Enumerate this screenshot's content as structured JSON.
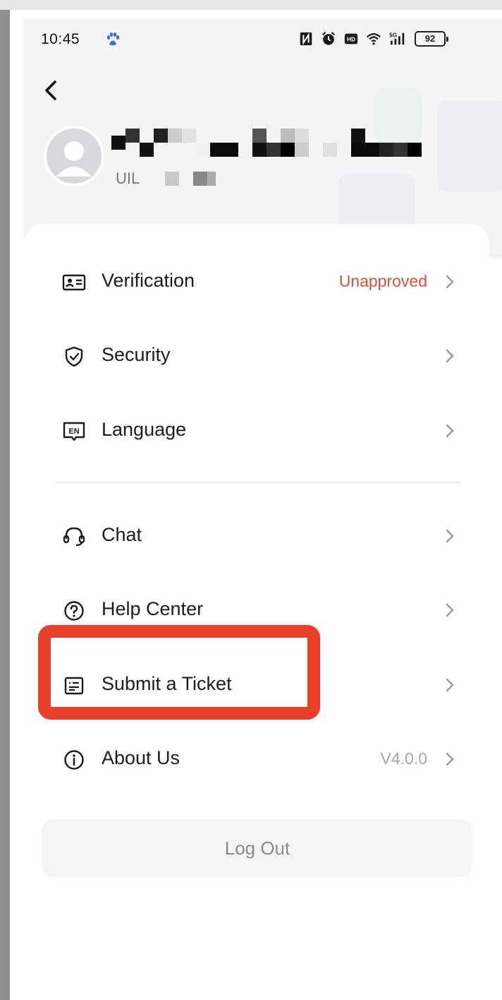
{
  "status_bar": {
    "time": "10:45",
    "battery": "92",
    "icons": [
      "baidu-paw-icon",
      "nfc-icon",
      "alarm-icon",
      "hd-icon",
      "wifi-icon",
      "5g-signal-icon",
      "battery-icon"
    ]
  },
  "header": {
    "back_icon": "chevron-left-icon"
  },
  "profile": {
    "uid_label": "UIL"
  },
  "menu": {
    "items": [
      {
        "label": "Verification",
        "value": "Unapproved",
        "icon": "id-card-icon"
      },
      {
        "label": "Security",
        "value": "",
        "icon": "shield-check-icon"
      },
      {
        "label": "Language",
        "value": "",
        "icon": "en-language-icon"
      },
      {
        "label": "Chat",
        "value": "",
        "icon": "headset-icon"
      },
      {
        "label": "Help Center",
        "value": "",
        "icon": "question-circle-icon"
      },
      {
        "label": "Submit a Ticket",
        "value": "",
        "icon": "ticket-icon"
      },
      {
        "label": "About Us",
        "value": "V4.0.0",
        "icon": "info-circle-icon"
      }
    ]
  },
  "logout_label": "Log Out",
  "colors": {
    "warning": "#d4523a",
    "highlight": "#e8402a",
    "header_bg": "#f3f4f6"
  }
}
